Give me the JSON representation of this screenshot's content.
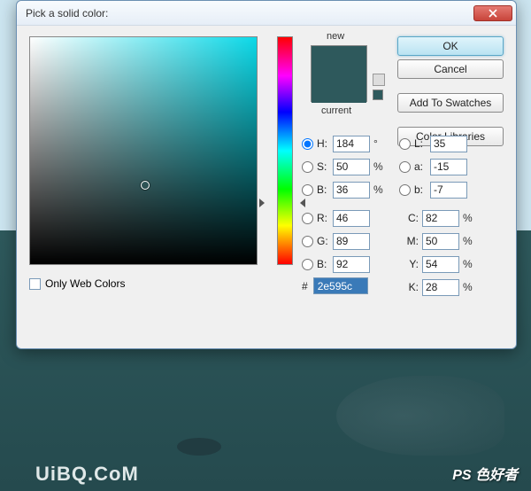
{
  "page": {
    "watermark_right": "PS 色好者",
    "watermark_left": "UiBQ.CoM"
  },
  "dialog": {
    "title": "Pick a solid color:",
    "buttons": {
      "ok": "OK",
      "cancel": "Cancel",
      "add_swatches": "Add To Swatches",
      "color_libraries": "Color Libraries"
    },
    "preview": {
      "new_label": "new",
      "current_label": "current",
      "new_color": "#2e595c",
      "current_color": "#2e595c"
    },
    "fields": {
      "H": {
        "label": "H:",
        "value": "184",
        "unit": "°"
      },
      "S": {
        "label": "S:",
        "value": "50",
        "unit": "%"
      },
      "Bv": {
        "label": "B:",
        "value": "36",
        "unit": "%"
      },
      "R": {
        "label": "R:",
        "value": "46",
        "unit": ""
      },
      "G": {
        "label": "G:",
        "value": "89",
        "unit": ""
      },
      "Bc": {
        "label": "B:",
        "value": "92",
        "unit": ""
      },
      "L": {
        "label": "L:",
        "value": "35",
        "unit": ""
      },
      "a": {
        "label": "a:",
        "value": "-15",
        "unit": ""
      },
      "b": {
        "label": "b:",
        "value": "-7",
        "unit": ""
      },
      "C": {
        "label": "C:",
        "value": "82",
        "unit": "%"
      },
      "M": {
        "label": "M:",
        "value": "50",
        "unit": "%"
      },
      "Y": {
        "label": "Y:",
        "value": "54",
        "unit": "%"
      },
      "K": {
        "label": "K:",
        "value": "28",
        "unit": "%"
      }
    },
    "hex": {
      "label": "#",
      "value": "2e595c"
    },
    "web_colors": "Only Web Colors"
  }
}
